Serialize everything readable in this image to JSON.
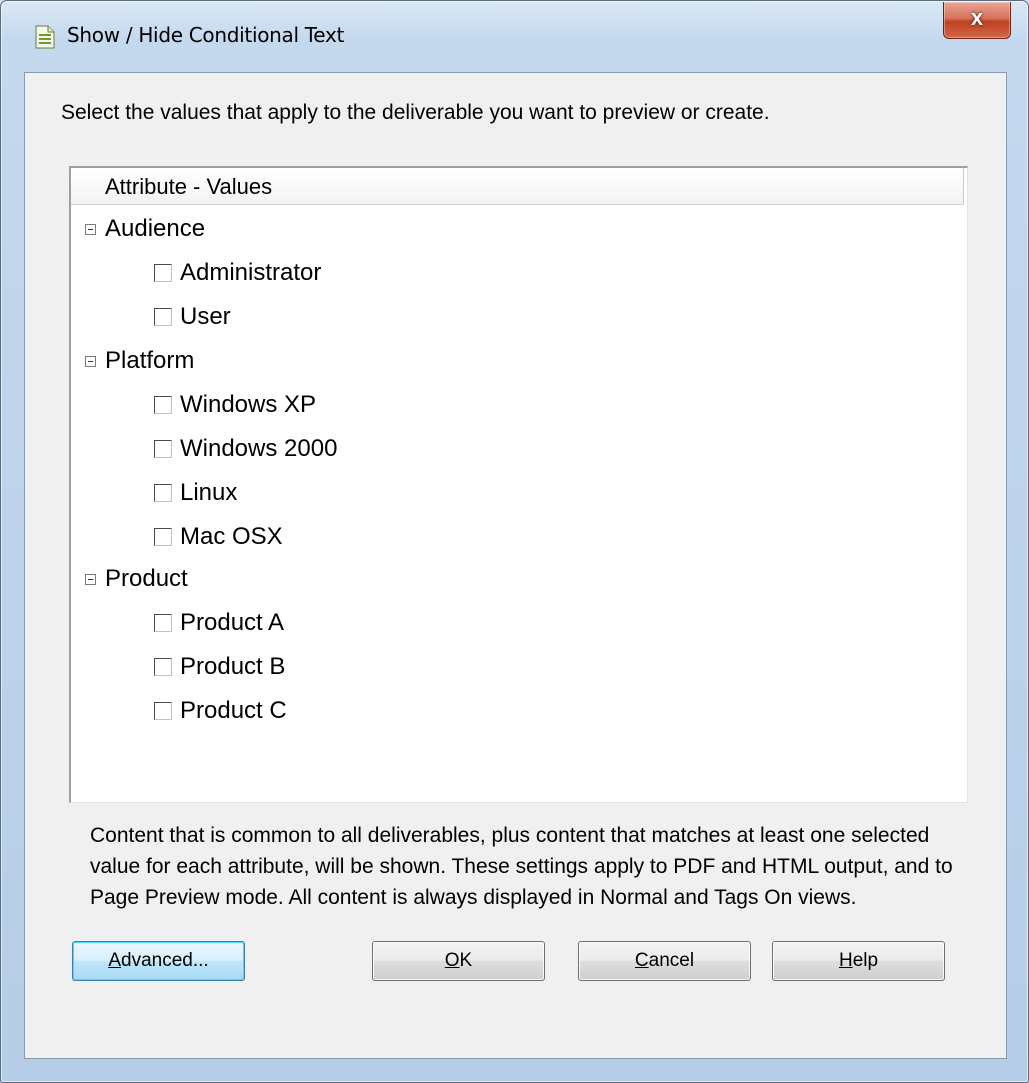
{
  "window": {
    "title": "Show / Hide Conditional Text",
    "close_label": "x"
  },
  "instruction": "Select the values that apply to the deliverable you want to preview or create.",
  "tree": {
    "header": "Attribute - Values",
    "groups": [
      {
        "label": "Audience",
        "expanded": true,
        "items": [
          {
            "label": "Administrator",
            "checked": false
          },
          {
            "label": "User",
            "checked": false
          }
        ]
      },
      {
        "label": "Platform",
        "expanded": true,
        "items": [
          {
            "label": "Windows XP",
            "checked": false
          },
          {
            "label": "Windows 2000",
            "checked": false
          },
          {
            "label": "Linux",
            "checked": false
          },
          {
            "label": "Mac OSX",
            "checked": false
          }
        ]
      },
      {
        "label": "Product",
        "expanded": true,
        "items": [
          {
            "label": "Product A",
            "checked": false
          },
          {
            "label": "Product B",
            "checked": false
          },
          {
            "label": "Product C",
            "checked": false
          }
        ]
      }
    ]
  },
  "explanation": "Content that is common to all deliverables, plus content that matches at least one selected value for each attribute, will be shown. These settings apply to PDF and HTML output, and to Page Preview mode. All content is always displayed in Normal and Tags On views.",
  "buttons": {
    "advanced": {
      "mnemonic": "A",
      "rest": "dvanced..."
    },
    "ok": {
      "mnemonic": "O",
      "rest": "K"
    },
    "cancel": {
      "mnemonic": "C",
      "rest": "ancel"
    },
    "help": {
      "mnemonic": "H",
      "rest": "elp"
    }
  }
}
